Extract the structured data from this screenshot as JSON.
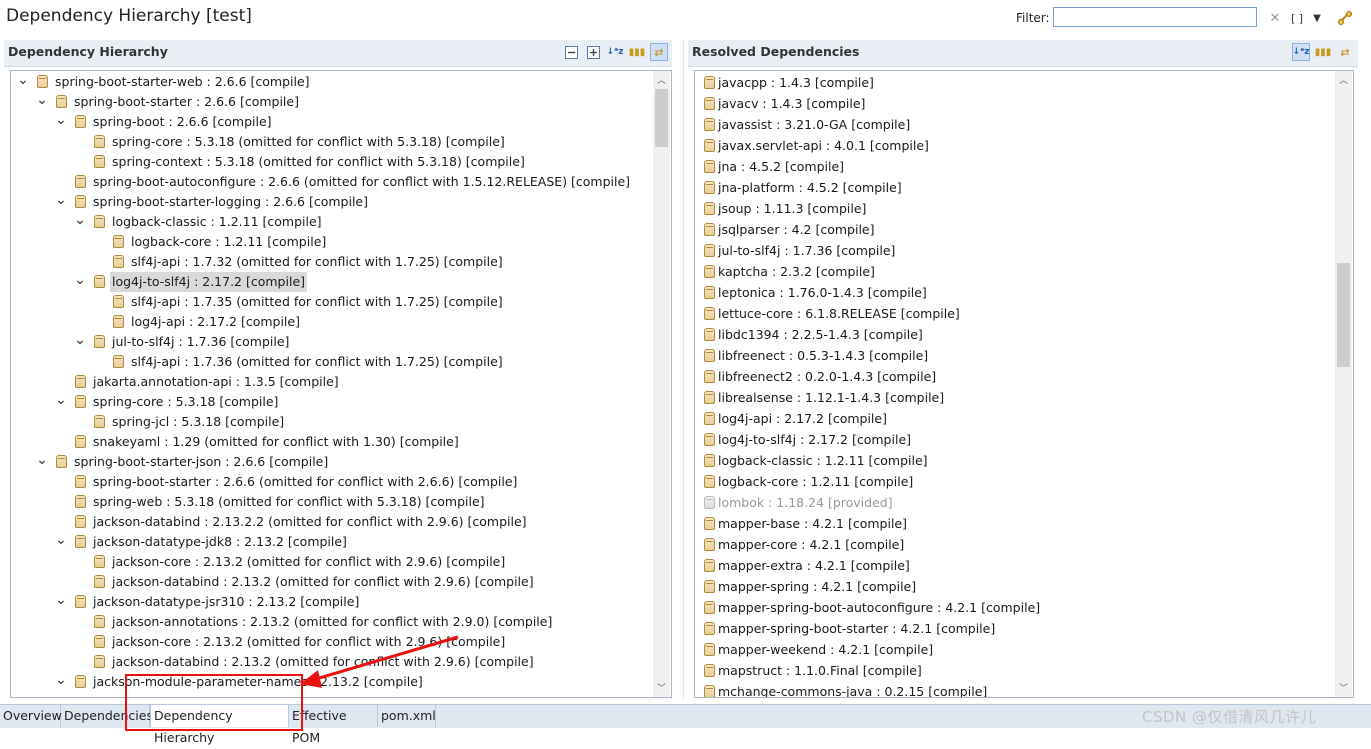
{
  "window": {
    "title": "Dependency Hierarchy [test]"
  },
  "filter": {
    "label": "Filter:",
    "value": "",
    "placeholder": ""
  },
  "toolbar_icons": [
    "clear-filter-icon",
    "bracket-toggle-icon",
    "view-menu-icon",
    "link-editor-icon"
  ],
  "left_panel": {
    "title": "Dependency Hierarchy",
    "icons": [
      "collapse-all-icon",
      "expand-all-icon",
      "sort-alpha-icon",
      "show-groupid-icon",
      "sync-selection-icon"
    ],
    "items": [
      {
        "label": "spring-boot-starter-web : 2.6.6 [compile]",
        "level": 0,
        "twisty": "open"
      },
      {
        "label": "spring-boot-starter : 2.6.6 [compile]",
        "level": 1,
        "twisty": "open"
      },
      {
        "label": "spring-boot : 2.6.6 [compile]",
        "level": 2,
        "twisty": "open"
      },
      {
        "label": "spring-core : 5.3.18 (omitted for conflict with 5.3.18) [compile]",
        "level": 3,
        "twisty": "none"
      },
      {
        "label": "spring-context : 5.3.18 (omitted for conflict with 5.3.18) [compile]",
        "level": 3,
        "twisty": "none"
      },
      {
        "label": "spring-boot-autoconfigure : 2.6.6 (omitted for conflict with 1.5.12.RELEASE) [compile]",
        "level": 2,
        "twisty": "none"
      },
      {
        "label": "spring-boot-starter-logging : 2.6.6 [compile]",
        "level": 2,
        "twisty": "open"
      },
      {
        "label": "logback-classic : 1.2.11 [compile]",
        "level": 3,
        "twisty": "open"
      },
      {
        "label": "logback-core : 1.2.11 [compile]",
        "level": 4,
        "twisty": "none"
      },
      {
        "label": "slf4j-api : 1.7.32 (omitted for conflict with 1.7.25) [compile]",
        "level": 4,
        "twisty": "none"
      },
      {
        "label": "log4j-to-slf4j : 2.17.2 [compile]",
        "level": 3,
        "twisty": "open",
        "selected": true
      },
      {
        "label": "slf4j-api : 1.7.35 (omitted for conflict with 1.7.25) [compile]",
        "level": 4,
        "twisty": "none"
      },
      {
        "label": "log4j-api : 2.17.2 [compile]",
        "level": 4,
        "twisty": "none"
      },
      {
        "label": "jul-to-slf4j : 1.7.36 [compile]",
        "level": 3,
        "twisty": "open"
      },
      {
        "label": "slf4j-api : 1.7.36 (omitted for conflict with 1.7.25) [compile]",
        "level": 4,
        "twisty": "none"
      },
      {
        "label": "jakarta.annotation-api : 1.3.5 [compile]",
        "level": 2,
        "twisty": "none"
      },
      {
        "label": "spring-core : 5.3.18 [compile]",
        "level": 2,
        "twisty": "open"
      },
      {
        "label": "spring-jcl : 5.3.18 [compile]",
        "level": 3,
        "twisty": "none"
      },
      {
        "label": "snakeyaml : 1.29 (omitted for conflict with 1.30) [compile]",
        "level": 2,
        "twisty": "none"
      },
      {
        "label": "spring-boot-starter-json : 2.6.6 [compile]",
        "level": 1,
        "twisty": "open"
      },
      {
        "label": "spring-boot-starter : 2.6.6 (omitted for conflict with 2.6.6) [compile]",
        "level": 2,
        "twisty": "none"
      },
      {
        "label": "spring-web : 5.3.18 (omitted for conflict with 5.3.18) [compile]",
        "level": 2,
        "twisty": "none"
      },
      {
        "label": "jackson-databind : 2.13.2.2 (omitted for conflict with 2.9.6) [compile]",
        "level": 2,
        "twisty": "none"
      },
      {
        "label": "jackson-datatype-jdk8 : 2.13.2 [compile]",
        "level": 2,
        "twisty": "open"
      },
      {
        "label": "jackson-core : 2.13.2 (omitted for conflict with 2.9.6) [compile]",
        "level": 3,
        "twisty": "none"
      },
      {
        "label": "jackson-databind : 2.13.2 (omitted for conflict with 2.9.6) [compile]",
        "level": 3,
        "twisty": "none"
      },
      {
        "label": "jackson-datatype-jsr310 : 2.13.2 [compile]",
        "level": 2,
        "twisty": "open"
      },
      {
        "label": "jackson-annotations : 2.13.2 (omitted for conflict with 2.9.0) [compile]",
        "level": 3,
        "twisty": "none"
      },
      {
        "label": "jackson-core : 2.13.2 (omitted for conflict with 2.9.6) [compile]",
        "level": 3,
        "twisty": "none"
      },
      {
        "label": "jackson-databind : 2.13.2 (omitted for conflict with 2.9.6) [compile]",
        "level": 3,
        "twisty": "none"
      },
      {
        "label": "jackson-module-parameter-names : 2.13.2 [compile]",
        "level": 2,
        "twisty": "open"
      }
    ]
  },
  "right_panel": {
    "title": "Resolved Dependencies",
    "icons": [
      "sort-alpha-icon",
      "show-groupid-icon",
      "sync-selection-icon"
    ],
    "items": [
      {
        "label": "javacpp : 1.4.3 [compile]"
      },
      {
        "label": "javacv : 1.4.3 [compile]"
      },
      {
        "label": "javassist : 3.21.0-GA [compile]"
      },
      {
        "label": "javax.servlet-api : 4.0.1 [compile]"
      },
      {
        "label": "jna : 4.5.2 [compile]"
      },
      {
        "label": "jna-platform : 4.5.2 [compile]"
      },
      {
        "label": "jsoup : 1.11.3 [compile]"
      },
      {
        "label": "jsqlparser : 4.2 [compile]"
      },
      {
        "label": "jul-to-slf4j : 1.7.36 [compile]"
      },
      {
        "label": "kaptcha : 2.3.2 [compile]"
      },
      {
        "label": "leptonica : 1.76.0-1.4.3 [compile]"
      },
      {
        "label": "lettuce-core : 6.1.8.RELEASE [compile]"
      },
      {
        "label": "libdc1394 : 2.2.5-1.4.3 [compile]"
      },
      {
        "label": "libfreenect : 0.5.3-1.4.3 [compile]"
      },
      {
        "label": "libfreenect2 : 0.2.0-1.4.3 [compile]"
      },
      {
        "label": "librealsense : 1.12.1-1.4.3 [compile]"
      },
      {
        "label": "log4j-api : 2.17.2 [compile]"
      },
      {
        "label": "log4j-to-slf4j : 2.17.2 [compile]"
      },
      {
        "label": "logback-classic : 1.2.11 [compile]"
      },
      {
        "label": "logback-core : 1.2.11 [compile]"
      },
      {
        "label": "lombok : 1.18.24 [provided]",
        "dim": true
      },
      {
        "label": "mapper-base : 4.2.1 [compile]"
      },
      {
        "label": "mapper-core : 4.2.1 [compile]"
      },
      {
        "label": "mapper-extra : 4.2.1 [compile]"
      },
      {
        "label": "mapper-spring : 4.2.1 [compile]"
      },
      {
        "label": "mapper-spring-boot-autoconfigure : 4.2.1 [compile]"
      },
      {
        "label": "mapper-spring-boot-starter : 4.2.1 [compile]"
      },
      {
        "label": "mapper-weekend : 4.2.1 [compile]"
      },
      {
        "label": "mapstruct : 1.1.0.Final [compile]"
      },
      {
        "label": "mchange-commons-java : 0.2.15 [compile]"
      }
    ]
  },
  "tabs": [
    {
      "label": "Overview"
    },
    {
      "label": "Dependencies"
    },
    {
      "label": "Dependency Hierarchy",
      "active": true
    },
    {
      "label": "Effective POM"
    },
    {
      "label": "pom.xml"
    }
  ],
  "watermark": "CSDN @仅借清风几许儿",
  "colors": {
    "annotation": "#ee1111",
    "selection": "#d9d9d9",
    "panel_header": "#e9eef4",
    "tab_bar": "#dfe7f1"
  }
}
